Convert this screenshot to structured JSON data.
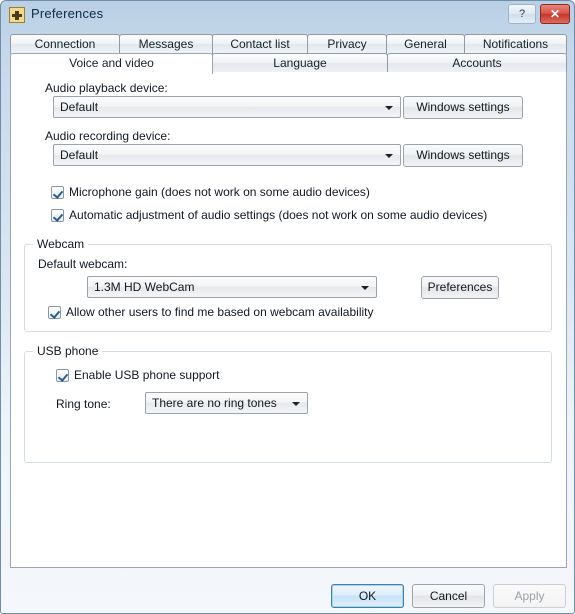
{
  "window": {
    "title": "Preferences",
    "icon": "app-icon",
    "help_button": "?",
    "close_button": "✕"
  },
  "tabs": {
    "row1": [
      {
        "label": "Connection",
        "selected": false
      },
      {
        "label": "Messages",
        "selected": false
      },
      {
        "label": "Contact list",
        "selected": false
      },
      {
        "label": "Privacy",
        "selected": false
      },
      {
        "label": "General",
        "selected": false
      },
      {
        "label": "Notifications",
        "selected": false
      }
    ],
    "row2": [
      {
        "label": "Voice and video",
        "selected": true
      },
      {
        "label": "Language",
        "selected": false
      },
      {
        "label": "Accounts",
        "selected": false
      }
    ]
  },
  "audio": {
    "playback_label": "Audio playback device:",
    "playback_value": "Default",
    "playback_settings_button": "Windows settings",
    "recording_label": "Audio recording device:",
    "recording_value": "Default",
    "recording_settings_button": "Windows settings",
    "mic_gain_checkbox": "Microphone gain (does not work on some audio devices)",
    "mic_gain_checked": true,
    "auto_adjust_checkbox": "Automatic adjustment of audio settings (does not work on some audio devices)",
    "auto_adjust_checked": true
  },
  "webcam": {
    "group_title": "Webcam",
    "default_label": "Default webcam:",
    "default_value": "1.3M HD WebCam",
    "preferences_button": "Preferences",
    "allow_find_checkbox": "Allow other users to find me based on webcam availability",
    "allow_find_checked": true
  },
  "usb_phone": {
    "group_title": "USB phone",
    "enable_checkbox": "Enable USB phone support",
    "enable_checked": true,
    "ringtone_label": "Ring tone:",
    "ringtone_value": "There are no ring tones"
  },
  "footer": {
    "ok_button": "OK",
    "cancel_button": "Cancel",
    "apply_button": "Apply",
    "apply_disabled": true
  },
  "colors": {
    "titlebar_accent": "#b9cfe4",
    "close_button": "#c4362c",
    "focus_border": "#3c7fb1",
    "checkmark": "#2b5d8c",
    "panel_bg": "#ffffff"
  }
}
